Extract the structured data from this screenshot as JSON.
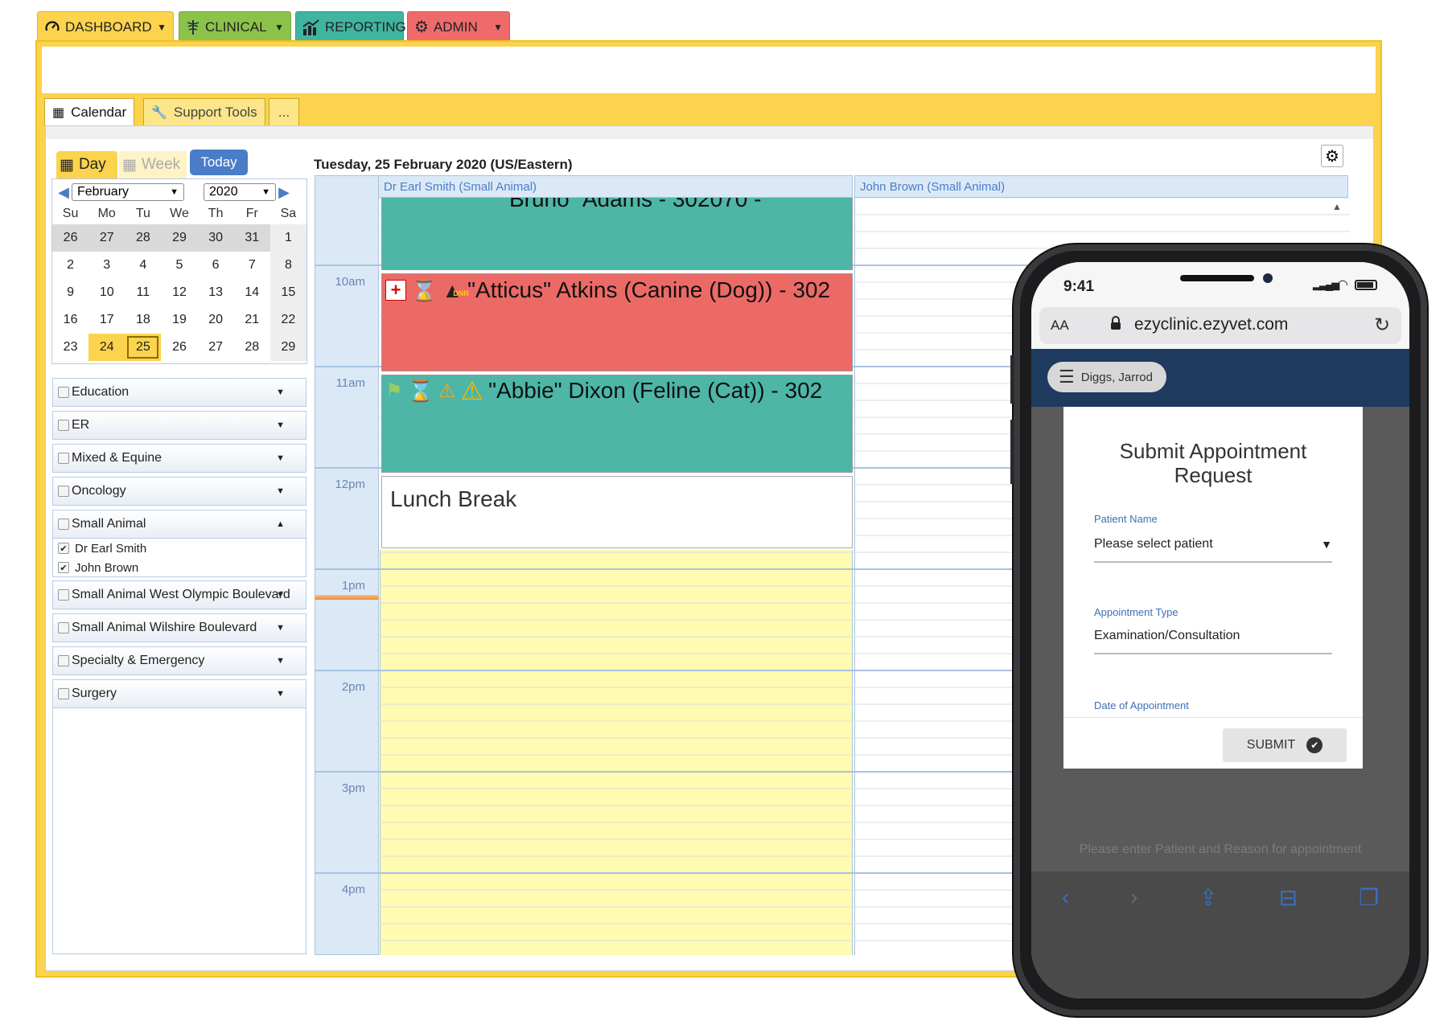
{
  "nav": {
    "dashboard": "DASHBOARD",
    "clinical": "CLINICAL",
    "reporting": "REPORTING",
    "admin": "ADMIN"
  },
  "subtabs": {
    "calendar": "Calendar",
    "support_tools": "Support Tools",
    "more": "..."
  },
  "view": {
    "day": "Day",
    "week": "Week",
    "today": "Today"
  },
  "date_heading": "Tuesday, 25 February 2020 (US/Eastern)",
  "mini_calendar": {
    "month": "February",
    "year": "2020",
    "weekdays": [
      "Su",
      "Mo",
      "Tu",
      "We",
      "Th",
      "Fr",
      "Sa"
    ],
    "weeks": [
      [
        "26",
        "27",
        "28",
        "29",
        "30",
        "31",
        "1"
      ],
      [
        "2",
        "3",
        "4",
        "5",
        "6",
        "7",
        "8"
      ],
      [
        "9",
        "10",
        "11",
        "12",
        "13",
        "14",
        "15"
      ],
      [
        "16",
        "17",
        "18",
        "19",
        "20",
        "21",
        "22"
      ],
      [
        "23",
        "24",
        "25",
        "26",
        "27",
        "28",
        "29"
      ]
    ],
    "today": "24",
    "selected": "25"
  },
  "groups": [
    {
      "label": "Education"
    },
    {
      "label": "ER"
    },
    {
      "label": "Mixed & Equine"
    },
    {
      "label": "Oncology"
    },
    {
      "label": "Small Animal"
    },
    {
      "label": "Small Animal West Olympic Boulevard"
    },
    {
      "label": "Small Animal Wilshire Boulevard"
    },
    {
      "label": "Specialty & Emergency"
    },
    {
      "label": "Surgery"
    }
  ],
  "small_animal_members": [
    {
      "label": "Dr Earl Smith",
      "checked": true
    },
    {
      "label": "John Brown",
      "checked": true
    }
  ],
  "columns": {
    "col1": "Dr Earl Smith (Small Animal)",
    "col2": "John Brown (Small Animal)"
  },
  "time_labels": [
    "10am",
    "11am",
    "12pm",
    "1pm",
    "2pm",
    "3pm",
    "4pm"
  ],
  "appointments": {
    "first": "\"Bruno\" Adams - 302070 -",
    "atticus": "\"Atticus\" Atkins (Canine (Dog)) - 302",
    "abbie": "\"Abbie\" Dixon (Feline (Cat)) - 302",
    "lunch": "Lunch Break"
  },
  "icon_badge": "DNR",
  "colors": {
    "teal": "#4db6a7",
    "red": "#ec6a66",
    "yellow_free": "#fffbb0",
    "frame_yellow": "#fcd34d",
    "phone_navbar": "#1e3a5f"
  },
  "phone": {
    "time": "9:41",
    "url": "ezyclinic.ezyvet.com",
    "aa": "AA",
    "user": "Diggs, Jarrod",
    "modal_title": "Submit Appointment Request",
    "patient_label": "Patient Name",
    "patient_value": "Please select patient",
    "type_label": "Appointment Type",
    "type_value": "Examination/Consultation",
    "date_label": "Date of Appointment",
    "submit": "SUBMIT",
    "footer_hint": "Please enter Patient and Reason for appointment"
  }
}
